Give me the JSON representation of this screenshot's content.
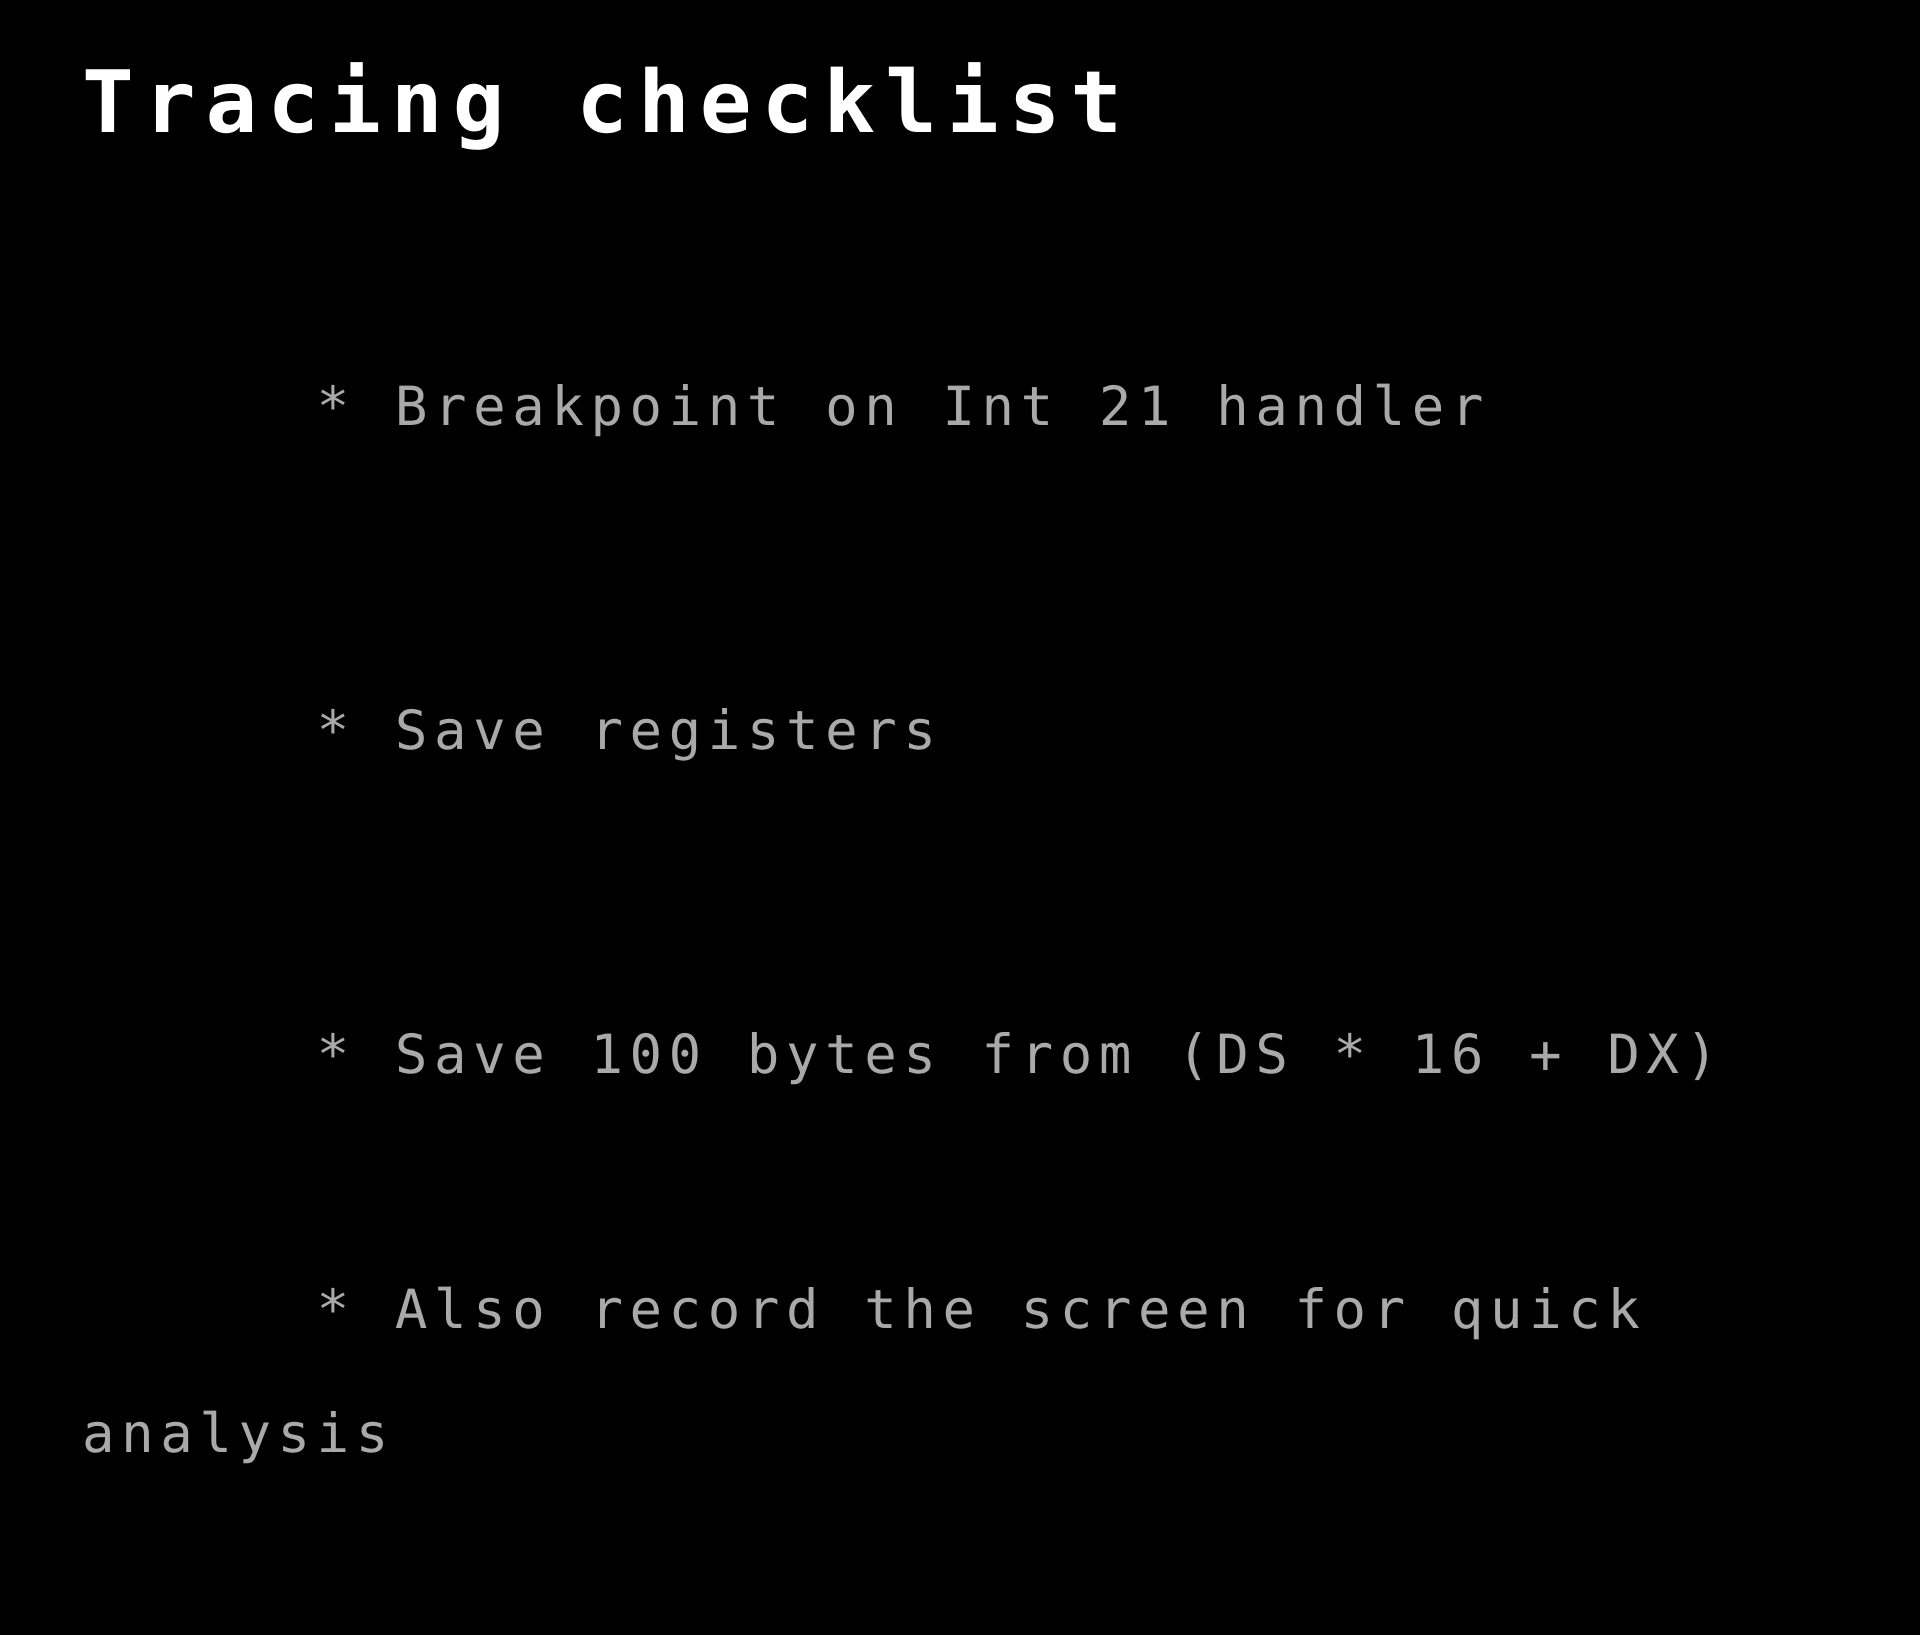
{
  "slide": {
    "background_color": "#000000",
    "title": "Tracing checklist",
    "title_color": "#ffffff",
    "body_color": "#a9a9a9",
    "bullet_marker": "*",
    "bullets": [
      {
        "marker": "*",
        "text": "Breakpoint on Int 21 handler",
        "full_line": "* Breakpoint on Int 21 handler",
        "continuation": ""
      },
      {
        "marker": "*",
        "text": "Save registers",
        "full_line": "* Save registers",
        "continuation": ""
      },
      {
        "marker": "*",
        "text": "Save 100 bytes from (DS * 16 + DX)",
        "full_line": "* Save 100 bytes from (DS * 16 + DX)",
        "continuation": ""
      },
      {
        "marker": "*",
        "text": "Also record the screen for quick analysis",
        "full_line": "* Also record the screen for quick",
        "continuation": "analysis"
      }
    ]
  }
}
